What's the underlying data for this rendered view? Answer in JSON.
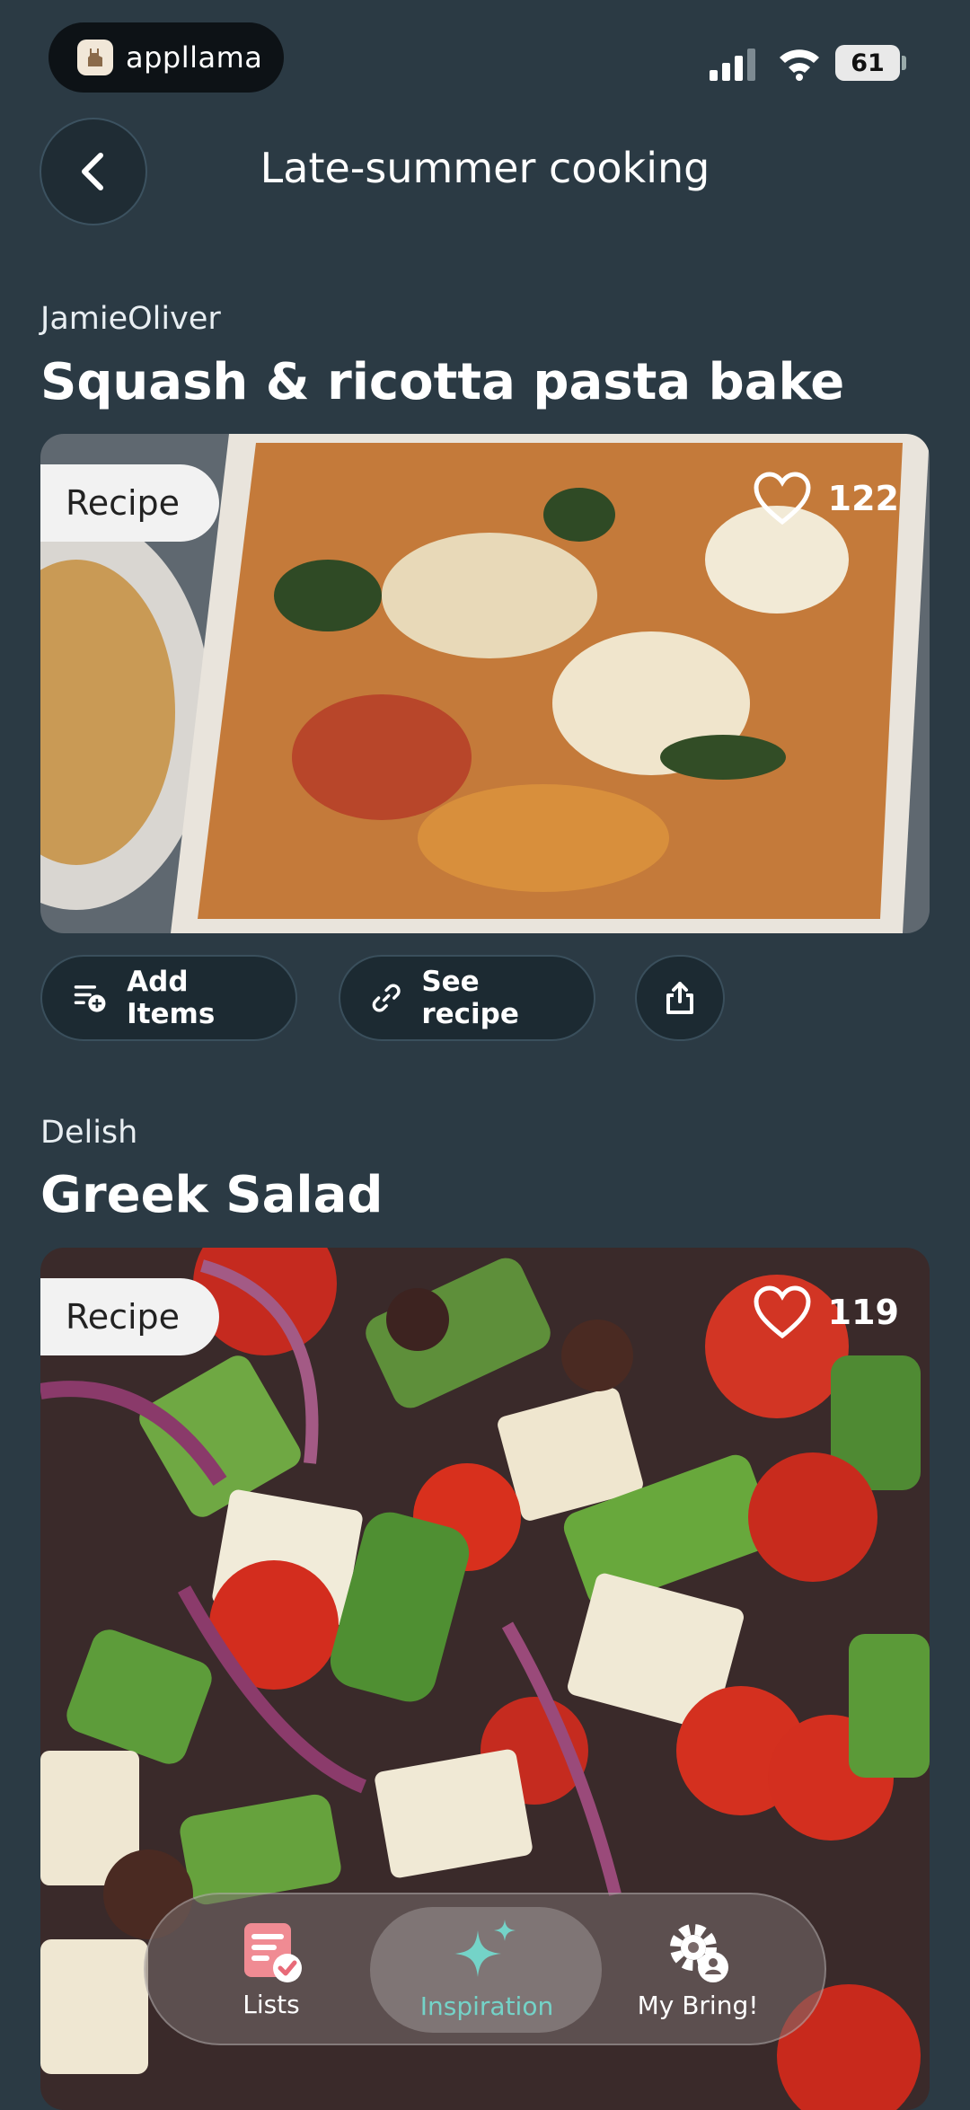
{
  "status_bar": {
    "carrier": "appllama",
    "battery": "61"
  },
  "header": {
    "title": "Late-summer cooking"
  },
  "recipes": [
    {
      "source": "JamieOliver",
      "title": "Squash & ricotta pasta bake",
      "type": "Recipe",
      "likes": "122"
    },
    {
      "source": "Delish",
      "title": "Greek Salad",
      "type": "Recipe",
      "likes": "119"
    }
  ],
  "actions": {
    "add_items": "Add Items",
    "see_recipe": "See recipe"
  },
  "tabs": [
    {
      "label": "Lists",
      "icon": "lists-icon"
    },
    {
      "label": "Inspiration",
      "icon": "sparkles-icon"
    },
    {
      "label": "My Bring!",
      "icon": "settings-profile-icon"
    }
  ],
  "colors": {
    "background": "#2b3a44",
    "accent": "#74d3c8",
    "tab_active": "#74d3c8"
  }
}
